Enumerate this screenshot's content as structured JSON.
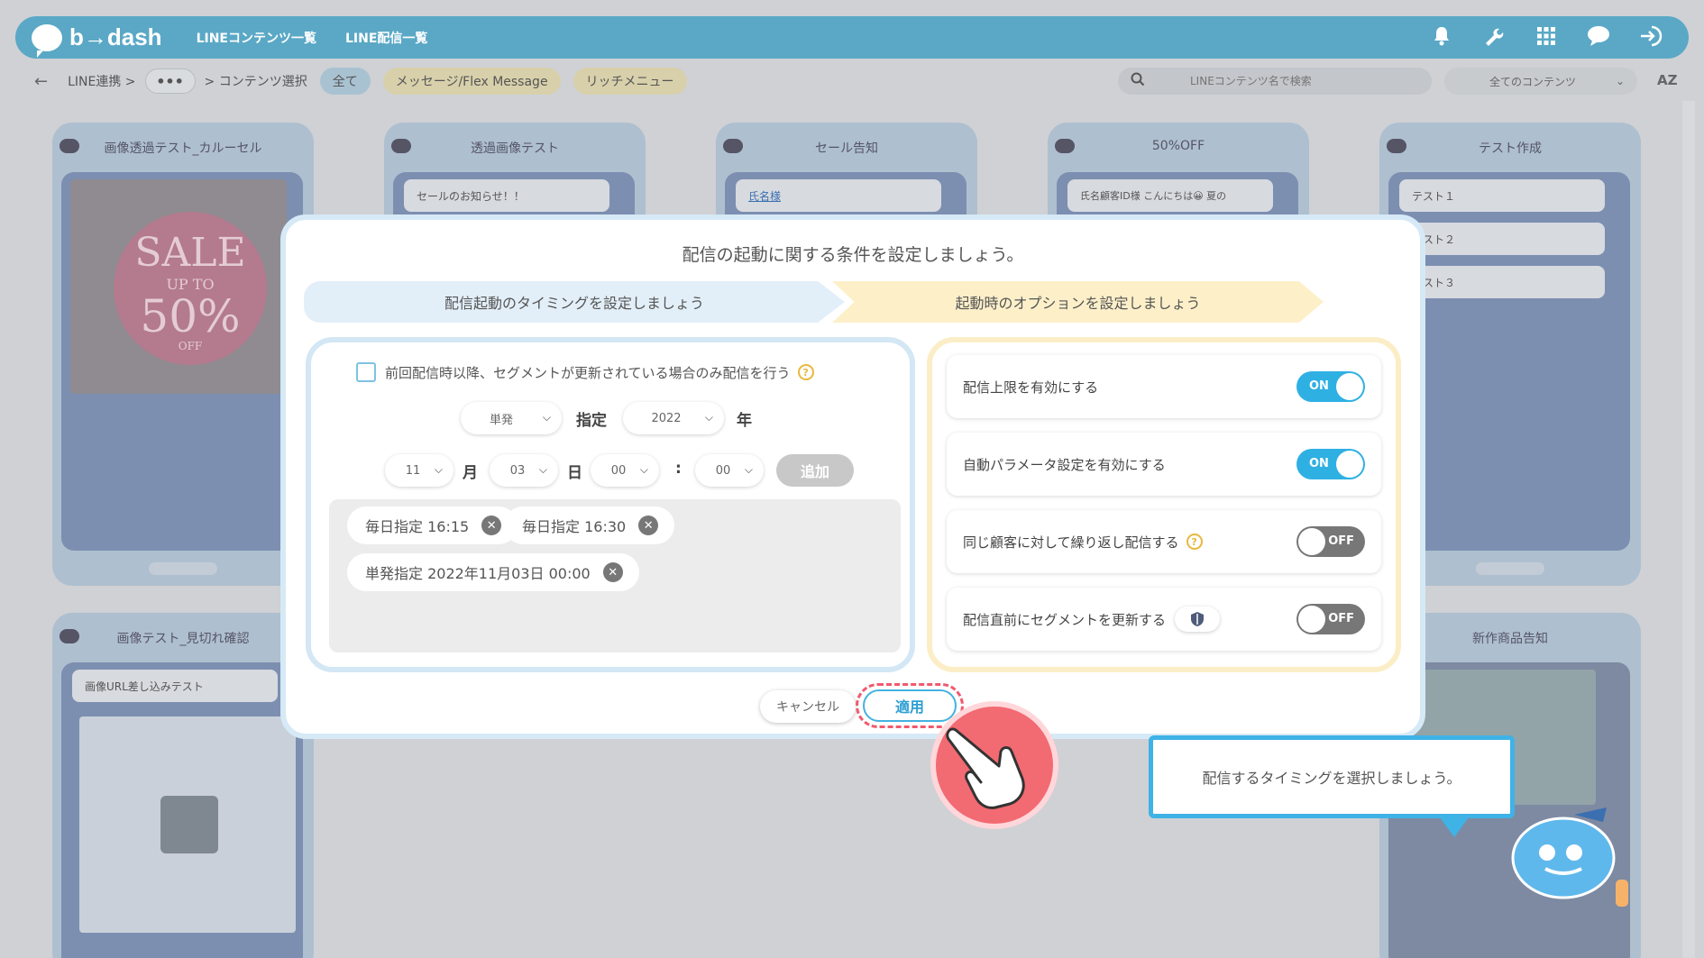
{
  "app": {
    "logo_text": "b→dash"
  },
  "topnav": {
    "items": [
      "LINEコンテンツ一覧",
      "LINE配信一覧"
    ]
  },
  "subbar": {
    "back_icon": "back-arrow-icon",
    "crumb1": "LINE連携 >",
    "crumb_more": "•••",
    "crumb2": "> コンテンツ選択",
    "tabs": [
      "全て",
      "メッセージ/Flex Message",
      "リッチメニュー"
    ],
    "search_placeholder": "LINEコンテンツ名で検索",
    "filter_selected": "全てのコンテンツ",
    "sort_label": "AZ"
  },
  "cards_row1": [
    {
      "title": "画像透過テスト_カルーセル"
    },
    {
      "title": "透過画像テスト",
      "msg": "セールのお知らせ！！"
    },
    {
      "title": "セール告知",
      "msg": "氏名様"
    },
    {
      "title": "50%OFF",
      "msg": "氏名顧客ID様 こんにちは😀 夏の"
    },
    {
      "title": "テスト作成",
      "msgs": [
        "テスト１",
        "テスト２",
        "テスト３"
      ]
    }
  ],
  "cards_row2": [
    {
      "title": "画像テスト_見切れ確認",
      "msg": "画像URL差し込みテスト"
    },
    {
      "title": "新作商品告知"
    }
  ],
  "sale_image": {
    "line1": "SALE",
    "line2": "UP TO",
    "line3": "50%",
    "line4": "OFF"
  },
  "modal": {
    "title": "配信の起動に関する条件を設定しましょう。",
    "step1": "配信起動のタイミングを設定しましょう",
    "step2": "起動時のオプションを設定しましょう",
    "left": {
      "checkbox_label": "前回配信時以降、セグメントが更新されている場合のみ配信を行う",
      "type_select": "単発",
      "type_suffix": "指定",
      "year_select": "2022",
      "year_suffix": "年",
      "month_select": "11",
      "month_suffix": "月",
      "day_select": "03",
      "day_suffix": "日",
      "hour_select": "00",
      "colon": ":",
      "minute_select": "00",
      "add_label": "追加",
      "chips": [
        "毎日指定 16:15",
        "毎日指定 16:30",
        "単発指定 2022年11月03日 00:00"
      ]
    },
    "options": [
      {
        "label": "配信上限を有効にする",
        "state": "ON"
      },
      {
        "label": "自動パラメータ設定を有効にする",
        "state": "ON"
      },
      {
        "label": "同じ顧客に対して繰り返し配信する",
        "state": "OFF"
      },
      {
        "label": "配信直前にセグメントを更新する",
        "state": "OFF"
      }
    ],
    "cancel_label": "キャンセル",
    "apply_label": "適用"
  },
  "tooltip": {
    "text": "配信するタイミングを選択しましょう。"
  },
  "colors": {
    "accent": "#2eb0e3",
    "highlight": "#f05a6e",
    "topbar": "#5aa8c6"
  }
}
